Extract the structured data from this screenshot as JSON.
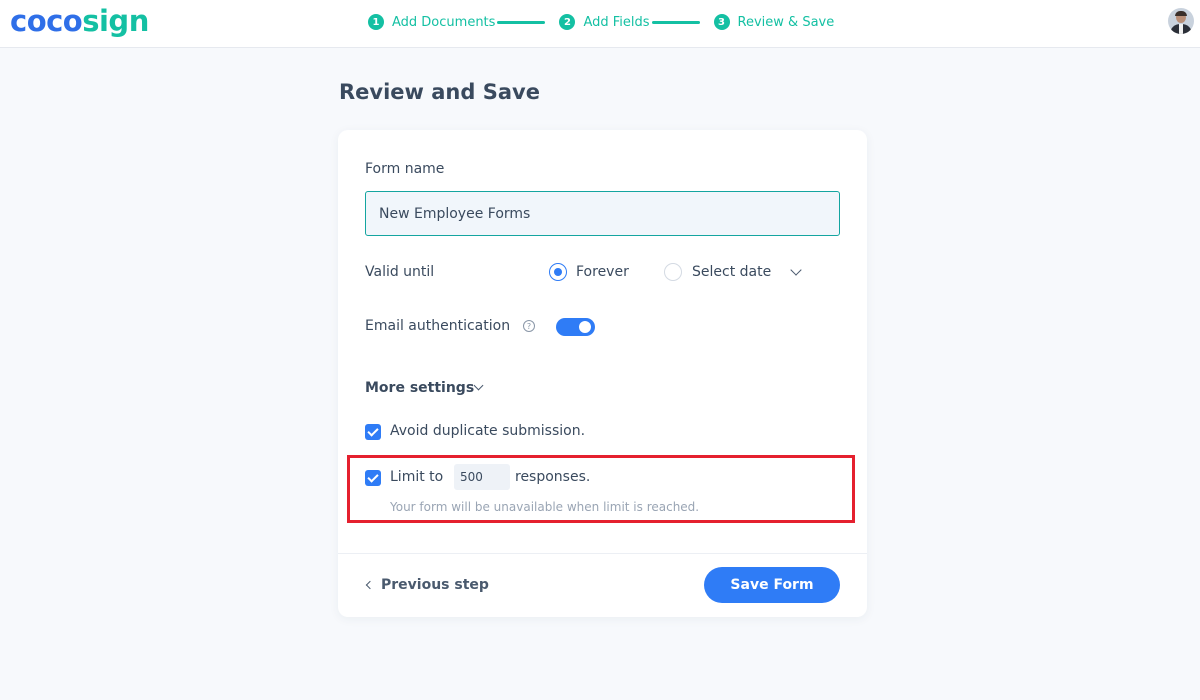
{
  "header": {
    "logo_part1": "coco",
    "logo_part2": "sign",
    "steps": [
      {
        "number": "1",
        "label": "Add Documents"
      },
      {
        "number": "2",
        "label": "Add Fields"
      },
      {
        "number": "3",
        "label": "Review & Save"
      }
    ],
    "accent_color": "#14c0a3",
    "brand_color": "#2f6fe8"
  },
  "page": {
    "title": "Review and Save"
  },
  "form": {
    "form_name_label": "Form name",
    "form_name_value": "New Employee Forms",
    "valid_until_label": "Valid until",
    "valid_options": [
      {
        "label": "Forever",
        "selected": true
      },
      {
        "label": "Select date",
        "selected": false
      }
    ],
    "email_auth_label": "Email authentication",
    "email_auth_enabled": true,
    "more_settings_label": "More settings",
    "avoid_duplicate_label": "Avoid duplicate submission.",
    "avoid_duplicate_checked": true,
    "limit_prefix": "Limit to",
    "limit_value": "500",
    "limit_suffix": "responses.",
    "limit_checked": true,
    "limit_hint": "Your form will be unavailable when limit is reached."
  },
  "footer": {
    "previous_label": "Previous step",
    "save_label": "Save Form"
  },
  "colors": {
    "primary": "#2f7cf6",
    "highlight_border": "#e5202e"
  }
}
